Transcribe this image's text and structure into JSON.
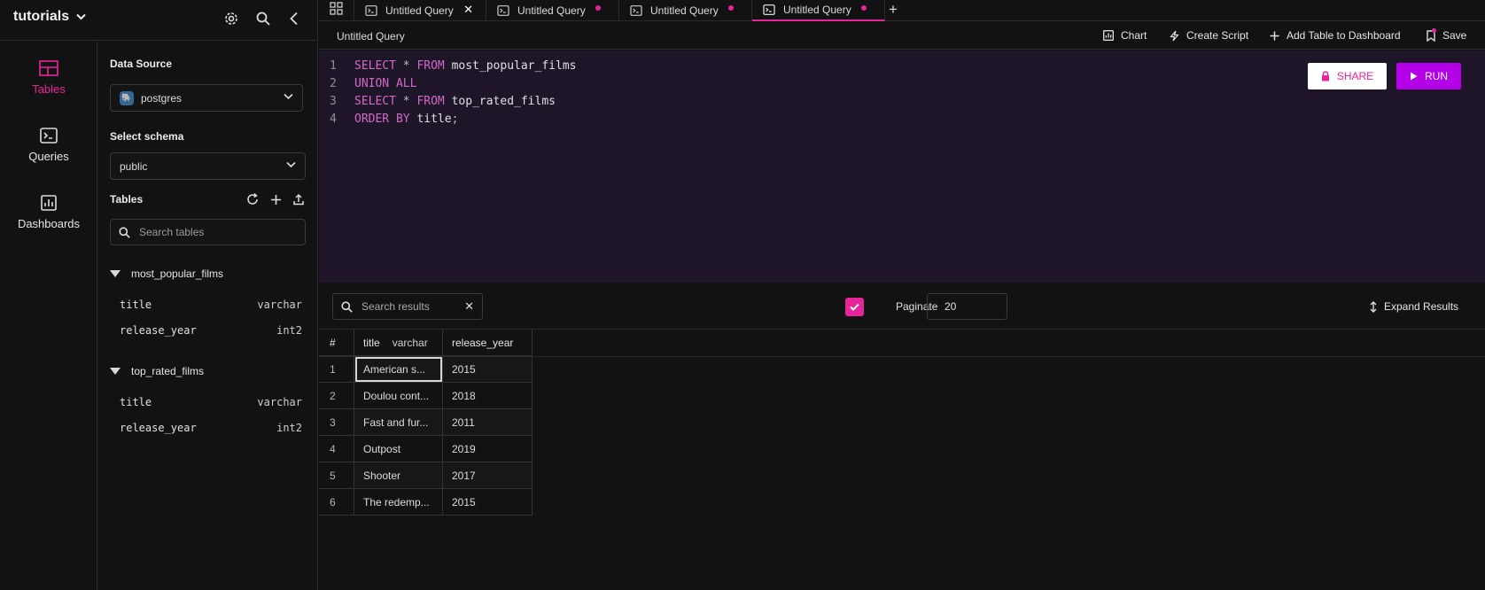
{
  "workspace": {
    "title": "tutorials"
  },
  "rail": {
    "items": [
      {
        "label": "Tables",
        "icon": "layout-table-icon",
        "active": true
      },
      {
        "label": "Queries",
        "icon": "terminal-icon",
        "active": false
      },
      {
        "label": "Dashboards",
        "icon": "bar-chart-icon",
        "active": false
      }
    ]
  },
  "explorer": {
    "data_source_label": "Data Source",
    "data_source_value": "postgres",
    "schema_label": "Select schema",
    "schema_value": "public",
    "tables_label": "Tables",
    "search_placeholder": "Search tables",
    "tables": [
      {
        "name": "most_popular_films",
        "columns": [
          {
            "name": "title",
            "type": "varchar"
          },
          {
            "name": "release_year",
            "type": "int2"
          }
        ]
      },
      {
        "name": "top_rated_films",
        "columns": [
          {
            "name": "title",
            "type": "varchar"
          },
          {
            "name": "release_year",
            "type": "int2"
          }
        ]
      }
    ]
  },
  "tabs": [
    {
      "label": "Untitled Query",
      "state": "close"
    },
    {
      "label": "Untitled Query",
      "state": "unsaved"
    },
    {
      "label": "Untitled Query",
      "state": "unsaved"
    },
    {
      "label": "Untitled Query",
      "state": "unsaved",
      "active": true
    }
  ],
  "query_bar": {
    "name": "Untitled Query",
    "chart": "Chart",
    "create_script": "Create Script",
    "add_to_dashboard": "Add Table to Dashboard",
    "save": "Save"
  },
  "editor": {
    "lines": [
      {
        "n": "1",
        "parts": [
          [
            "kw",
            "SELECT"
          ],
          [
            "pn",
            " * "
          ],
          [
            "kw",
            "FROM"
          ],
          [
            "id",
            " most_popular_films"
          ]
        ]
      },
      {
        "n": "2",
        "parts": [
          [
            "kw",
            "UNION ALL"
          ]
        ]
      },
      {
        "n": "3",
        "parts": [
          [
            "kw",
            "SELECT"
          ],
          [
            "pn",
            " * "
          ],
          [
            "kw",
            "FROM"
          ],
          [
            "id",
            " top_rated_films"
          ]
        ]
      },
      {
        "n": "4",
        "parts": [
          [
            "kw",
            "ORDER BY"
          ],
          [
            "id",
            " title"
          ],
          [
            "pn",
            ";"
          ]
        ]
      }
    ],
    "share": "SHARE",
    "run": "RUN"
  },
  "results": {
    "search_placeholder": "Search results",
    "paginate_label": "Paginate",
    "paginate_checked": true,
    "page_size": "20",
    "expand": "Expand Results",
    "headers": {
      "num": "#",
      "title": "title",
      "title_type": "varchar",
      "year": "release_year"
    },
    "rows": [
      {
        "n": "1",
        "title": "American s...",
        "year": "2015"
      },
      {
        "n": "2",
        "title": "Doulou cont...",
        "year": "2018"
      },
      {
        "n": "3",
        "title": "Fast and fur...",
        "year": "2011"
      },
      {
        "n": "4",
        "title": "Outpost",
        "year": "2019"
      },
      {
        "n": "5",
        "title": "Shooter",
        "year": "2017"
      },
      {
        "n": "6",
        "title": "The redemp...",
        "year": "2015"
      }
    ]
  },
  "colors": {
    "accent": "#e8249b",
    "run": "#b400e8",
    "editor_bg": "#1e1528",
    "background": "#121212"
  }
}
